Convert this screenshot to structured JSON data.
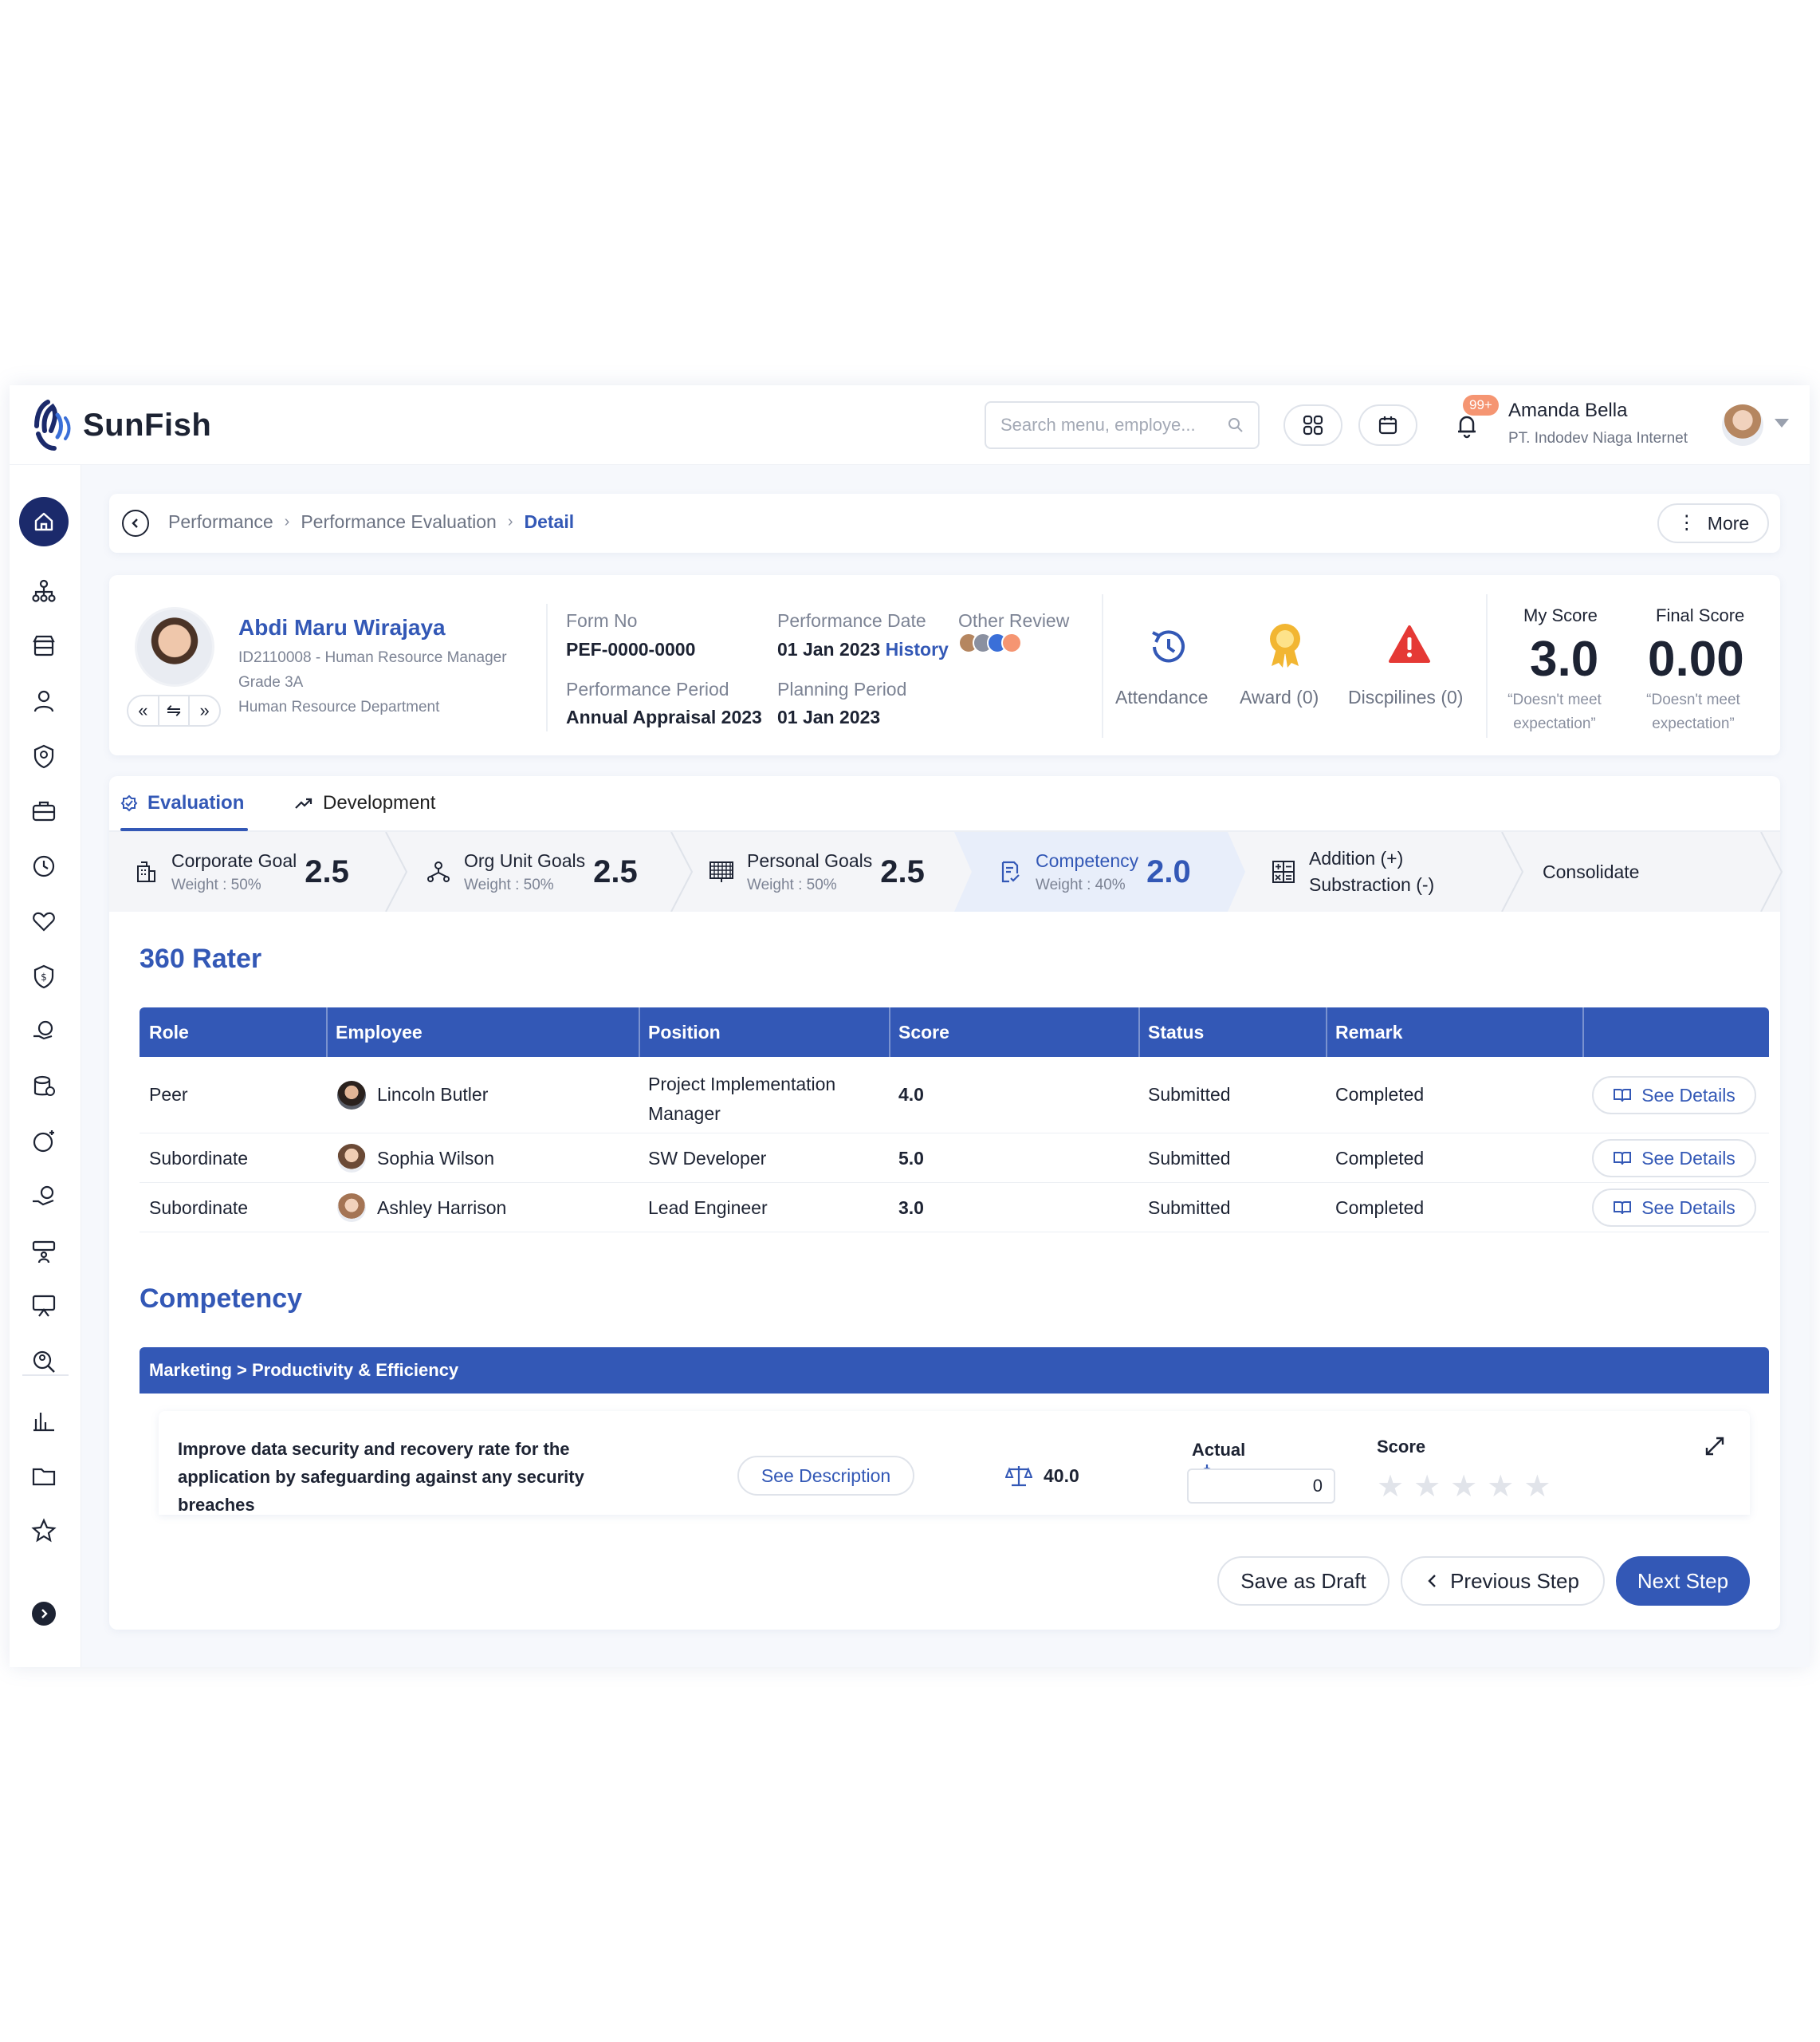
{
  "app": {
    "name": "SunFish"
  },
  "header": {
    "search_placeholder": "Search menu, employe...",
    "notification_count": "99+",
    "user_name": "Amanda Bella",
    "user_company": "PT. Indodev Niaga Internet"
  },
  "sidebar": {
    "items": [
      "home-icon",
      "org-structure-icon",
      "store-icon",
      "person-icon",
      "shield-user-icon",
      "briefcase-icon",
      "clock-icon",
      "heart-hand-icon",
      "benefit-shield-icon",
      "hand-coin-icon",
      "database-money-icon",
      "coin-plus-icon",
      "hand-money-icon",
      "training-icon",
      "presentation-icon",
      "search-person-icon",
      "chart-icon",
      "folder-icon",
      "star-icon"
    ]
  },
  "breadcrumb": {
    "items": [
      "Performance",
      "Performance Evaluation"
    ],
    "current": "Detail",
    "more_label": "More"
  },
  "employee": {
    "name": "Abdi Maru Wirajaya",
    "id_position": "ID2110008 - Human Resource Manager",
    "grade": "Grade 3A",
    "department": "Human Resource Department"
  },
  "form": {
    "form_no_label": "Form No",
    "form_no": "PEF-0000-0000",
    "perf_date_label": "Performance Date",
    "perf_date": "01 Jan 2023",
    "history_label": "History",
    "other_review_label": "Other Review",
    "perf_period_label": "Performance Period",
    "perf_period": "Annual Appraisal 2023",
    "planning_period_label": "Planning Period",
    "planning_period": "01 Jan 2023"
  },
  "stats": {
    "attendance": "Attendance",
    "award": "Award (0)",
    "disciplines": "Discpilines (0)"
  },
  "scores": {
    "my_score_label": "My Score",
    "my_score": "3.0",
    "my_score_note_1": "“Doesn't meet",
    "my_score_note_2": "expectation”",
    "final_score_label": "Final Score",
    "final_score": "0.00",
    "final_score_note_1": "“Doesn't meet",
    "final_score_note_2": "expectation”"
  },
  "tabs": {
    "evaluation": "Evaluation",
    "development": "Development"
  },
  "steps": [
    {
      "name": "Corporate Goal",
      "weight": "Weight : 50%",
      "score": "2.5"
    },
    {
      "name": "Org Unit Goals",
      "weight": "Weight : 50%",
      "score": "2.5"
    },
    {
      "name": "Personal Goals",
      "weight": "Weight : 50%",
      "score": "2.5"
    },
    {
      "name": "Competency",
      "weight": "Weight : 40%",
      "score": "2.0"
    },
    {
      "name_1": "Addition (+)",
      "name_2": "Substraction (-)"
    },
    {
      "name": "Consolidate"
    }
  ],
  "rater": {
    "title": "360 Rater",
    "columns": [
      "Role",
      "Employee",
      "Position",
      "Score",
      "Status",
      "Remark"
    ],
    "rows": [
      {
        "role": "Peer",
        "employee": "Lincoln Butler",
        "position_1": "Project Implementation",
        "position_2": "Manager",
        "score": "4.0",
        "status": "Submitted",
        "remark": "Completed"
      },
      {
        "role": "Subordinate",
        "employee": "Sophia Wilson",
        "position_1": "SW Developer",
        "position_2": "",
        "score": "5.0",
        "status": "Submitted",
        "remark": "Completed"
      },
      {
        "role": "Subordinate",
        "employee": "Ashley Harrison",
        "position_1": "Lead Engineer",
        "position_2": "",
        "score": "3.0",
        "status": "Submitted",
        "remark": "Completed"
      }
    ],
    "see_details_label": "See Details"
  },
  "competency": {
    "title": "Competency",
    "group": "Marketing > Productivity & Efficiency",
    "item_text": "Improve data security and recovery rate for the application by safeguarding against any security breaches",
    "see_description_label": "See Description",
    "weight": "40.0",
    "target": "4",
    "actual_label": "Actual",
    "actual_value": "0",
    "score_label": "Score",
    "rating": 0,
    "rating_max": 5
  },
  "footer": {
    "save_draft": "Save as Draft",
    "previous": "Previous Step",
    "next": "Next Step"
  },
  "colors": {
    "primary": "#3358b6",
    "navy": "#1b2a6b",
    "badge": "#f59572",
    "danger": "#e53935",
    "award": "#f2b632"
  }
}
